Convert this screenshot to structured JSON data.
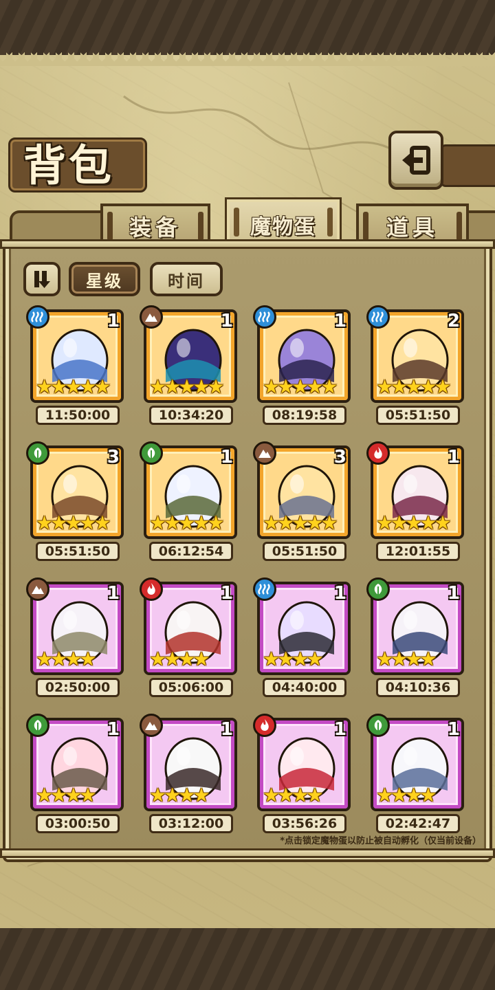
{
  "header": {
    "title": "背包",
    "back_icon": "back-arrow-icon"
  },
  "tabs": [
    {
      "label": "装备",
      "active": false
    },
    {
      "label": "魔物蛋",
      "active": true
    },
    {
      "label": "道具",
      "active": false
    }
  ],
  "sort": {
    "toggle_icon": "sort-order-icon",
    "options": [
      {
        "label": "星级",
        "active": true
      },
      {
        "label": "时间",
        "active": false
      }
    ]
  },
  "eggs": [
    {
      "element": "water",
      "count": "1",
      "stars": 5,
      "rarity": "gold",
      "time": "11:50:00",
      "art": "blue-crystal-egg"
    },
    {
      "element": "earth",
      "count": "1",
      "stars": 5,
      "rarity": "gold",
      "time": "10:34:20",
      "art": "dark-rock-egg"
    },
    {
      "element": "water",
      "count": "1",
      "stars": 5,
      "rarity": "gold",
      "time": "08:19:58",
      "art": "pocket-watch-egg"
    },
    {
      "element": "water",
      "count": "2",
      "stars": 5,
      "rarity": "gold",
      "time": "05:51:50",
      "art": "staff-egg"
    },
    {
      "element": "nature",
      "count": "3",
      "stars": 5,
      "rarity": "gold",
      "time": "05:51:50",
      "art": "lyre-egg"
    },
    {
      "element": "nature",
      "count": "1",
      "stars": 5,
      "rarity": "gold",
      "time": "06:12:54",
      "art": "wing-egg"
    },
    {
      "element": "earth",
      "count": "3",
      "stars": 5,
      "rarity": "gold",
      "time": "05:51:50",
      "art": "sword-egg"
    },
    {
      "element": "fire",
      "count": "1",
      "stars": 5,
      "rarity": "gold",
      "time": "12:01:55",
      "art": "flower-egg"
    },
    {
      "element": "earth",
      "count": "1",
      "stars": 4,
      "rarity": "purple",
      "time": "02:50:00",
      "art": "feather-egg"
    },
    {
      "element": "fire",
      "count": "1",
      "stars": 4,
      "rarity": "purple",
      "time": "05:06:00",
      "art": "hood-egg"
    },
    {
      "element": "water",
      "count": "1",
      "stars": 4,
      "rarity": "purple",
      "time": "04:40:00",
      "art": "rabbit-egg"
    },
    {
      "element": "nature",
      "count": "1",
      "stars": 4,
      "rarity": "purple",
      "time": "04:10:36",
      "art": "hat-egg"
    },
    {
      "element": "nature",
      "count": "1",
      "stars": 4,
      "rarity": "purple",
      "time": "03:00:50",
      "art": "pink-egg"
    },
    {
      "element": "earth",
      "count": "1",
      "stars": 4,
      "rarity": "purple",
      "time": "03:12:00",
      "art": "cracked-egg"
    },
    {
      "element": "fire",
      "count": "1",
      "stars": 4,
      "rarity": "purple",
      "time": "03:56:26",
      "art": "kimono-egg"
    },
    {
      "element": "nature",
      "count": "1",
      "stars": 4,
      "rarity": "purple",
      "time": "02:42:47",
      "art": "white-wing-egg"
    }
  ],
  "footer_hint": "*点击锁定魔物蛋以防止被自动孵化（仅当前设备）"
}
